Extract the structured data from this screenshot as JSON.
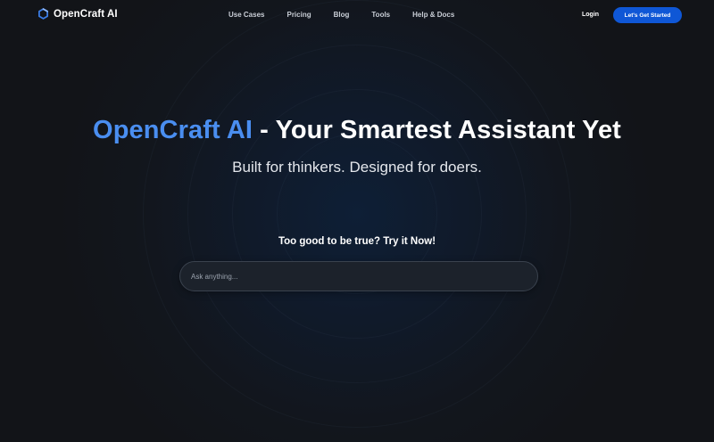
{
  "header": {
    "brand": "OpenCraft AI",
    "logo_icon": "hexagon-ring-icon",
    "nav": [
      {
        "label": "Use Cases"
      },
      {
        "label": "Pricing"
      },
      {
        "label": "Blog"
      },
      {
        "label": "Tools"
      },
      {
        "label": "Help & Docs"
      }
    ],
    "login_label": "Login",
    "cta_label": "Let's Get Started"
  },
  "hero": {
    "title_brand": "OpenCraft AI",
    "title_rest": " - Your Smartest Assistant Yet",
    "subtitle": "Built for thinkers. Designed for doers.",
    "tagline": "Too good to be true? Try it Now!",
    "search_placeholder": "Ask anything..."
  },
  "colors": {
    "accent": "#4a8ef0",
    "cta_bg": "#0f57d6",
    "background": "#121418"
  }
}
